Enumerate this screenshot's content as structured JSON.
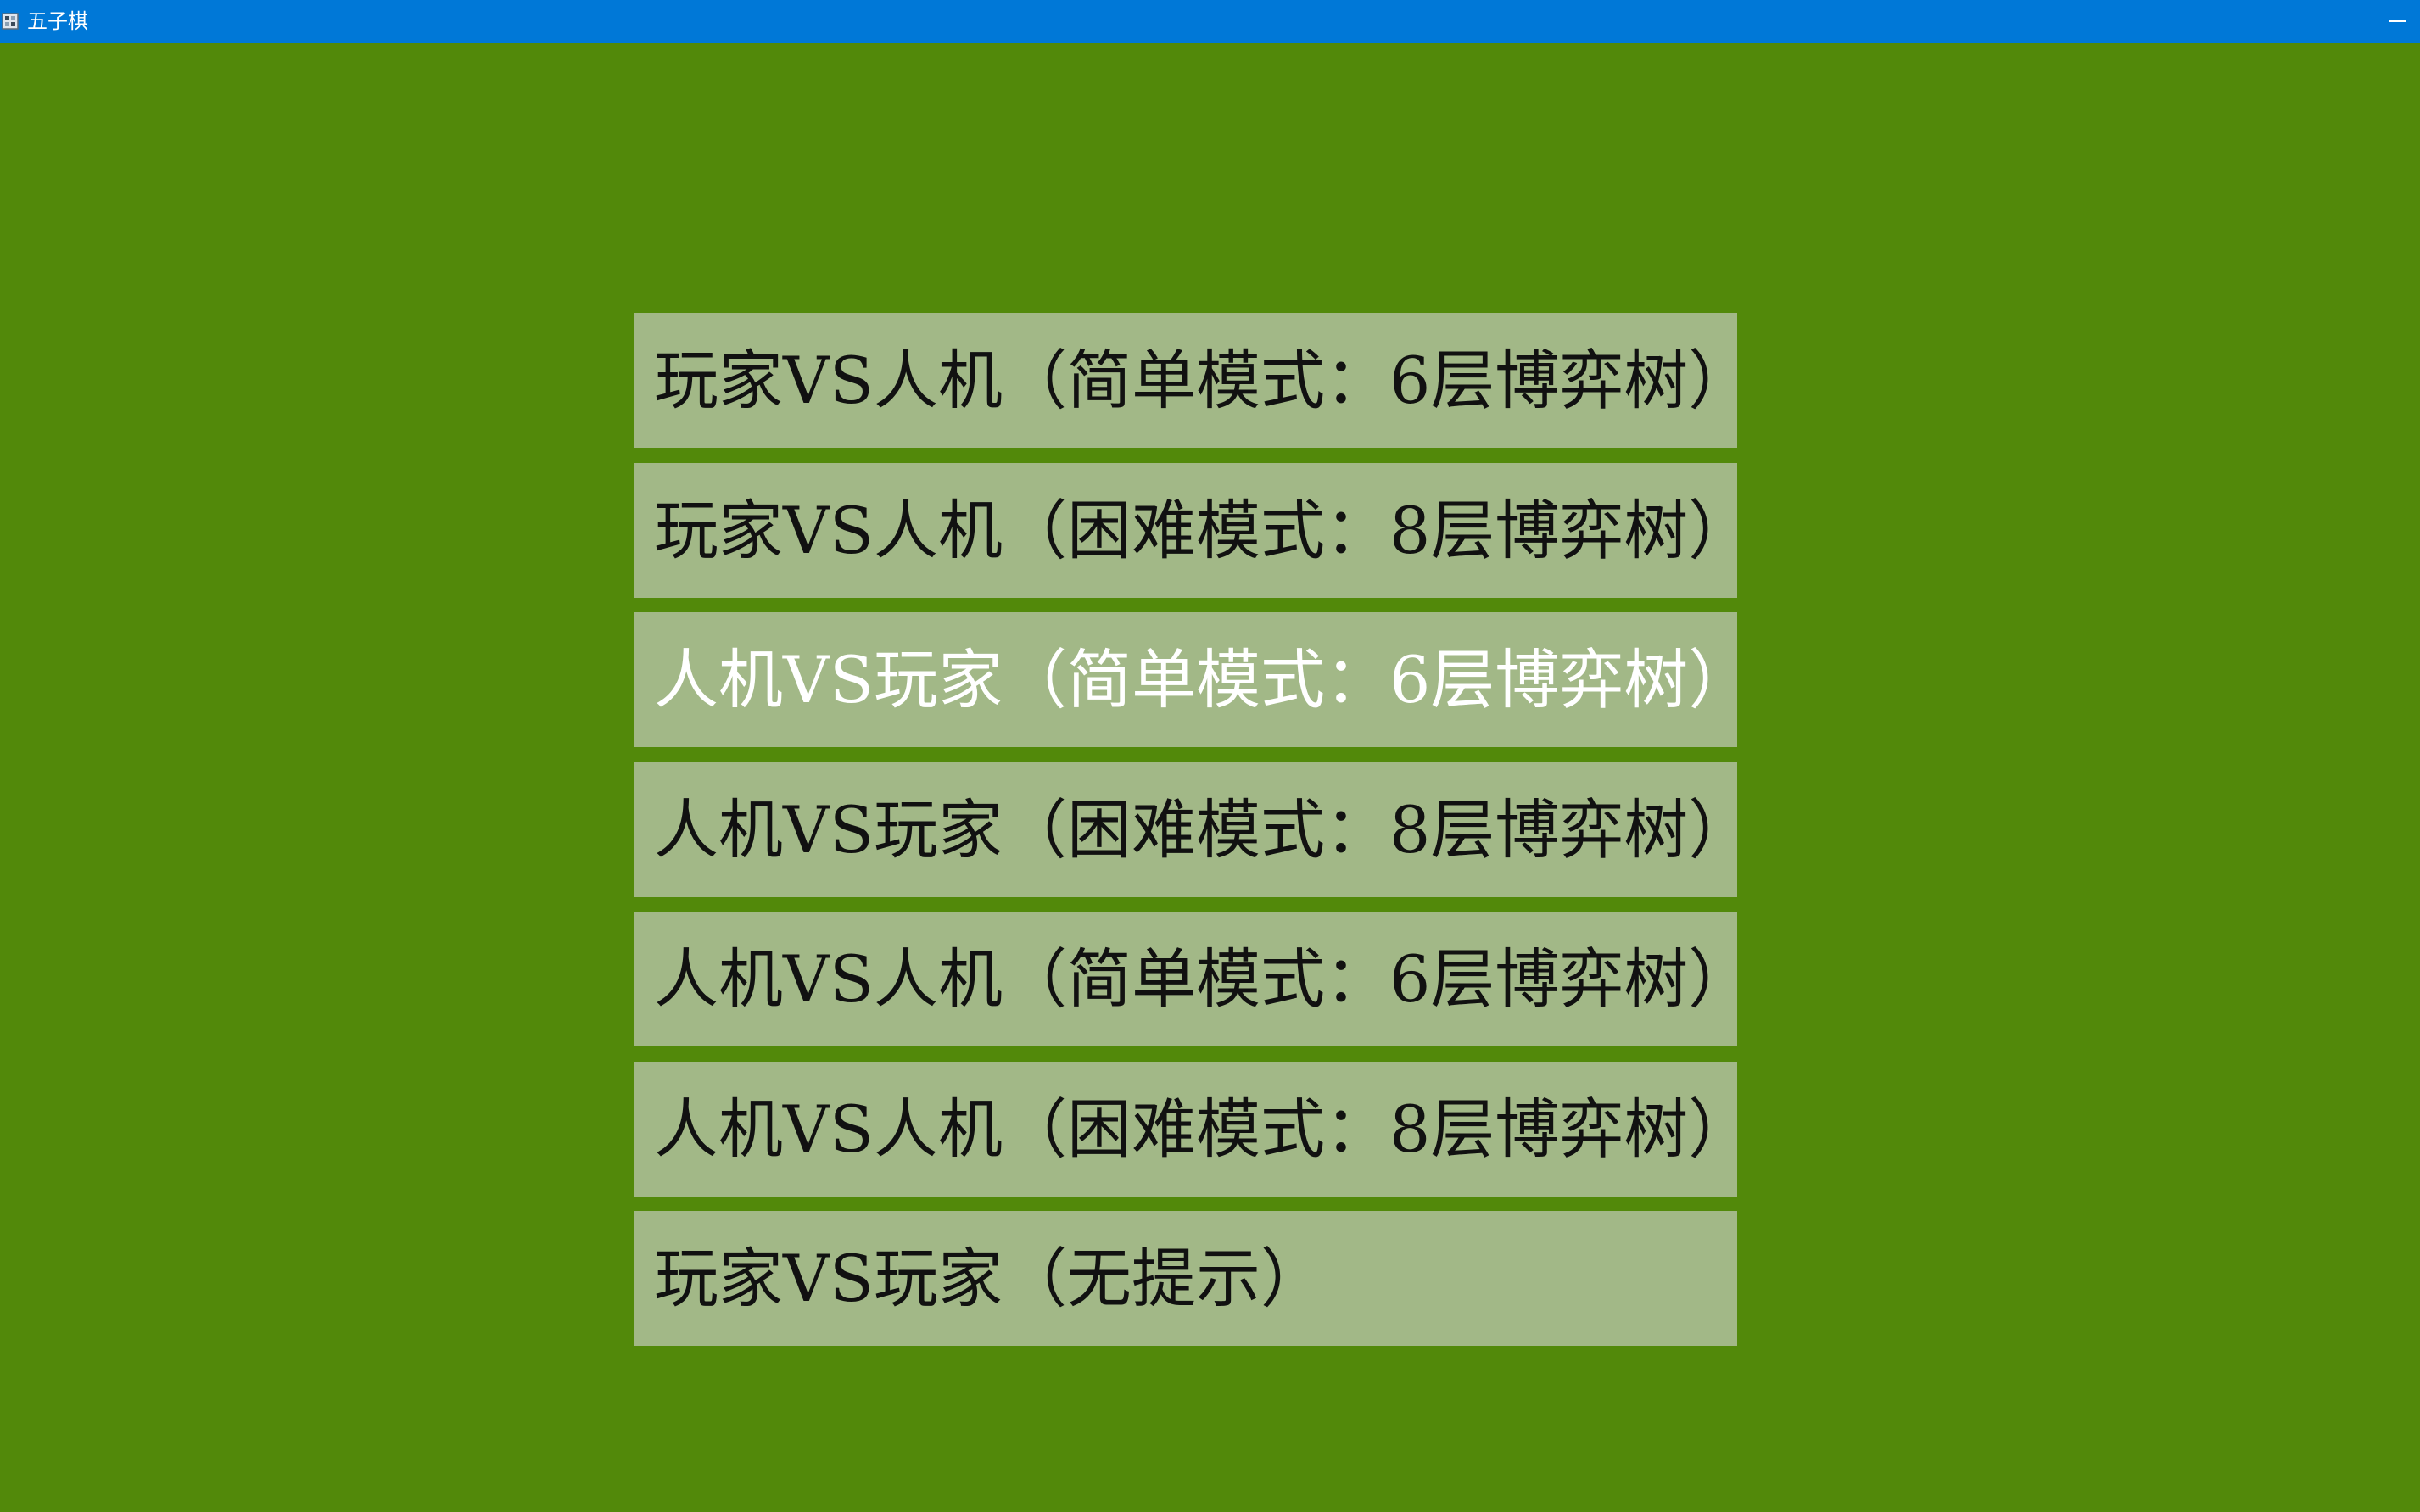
{
  "window": {
    "title": "五子棋"
  },
  "menu": {
    "items": [
      {
        "label": "玩家VS人机（简单模式：6层博弈树）"
      },
      {
        "label": "玩家VS人机（困难模式：8层博弈树）"
      },
      {
        "label": "人机VS玩家（简单模式：6层博弈树）"
      },
      {
        "label": "人机VS玩家（困难模式：8层博弈树）"
      },
      {
        "label": "人机VS人机（简单模式：6层博弈树）"
      },
      {
        "label": "人机VS人机（困难模式：8层博弈树）"
      },
      {
        "label": "玩家VS玩家（无提示）"
      }
    ],
    "highlighted_index": 2
  },
  "colors": {
    "titlebar": "#0078d7",
    "background": "#52890a",
    "button": "#a2b887",
    "button_text": "#111111",
    "button_text_highlighted": "#ffffff"
  },
  "icons": {
    "app": "app-window-icon",
    "minimize": "minimize-icon"
  }
}
